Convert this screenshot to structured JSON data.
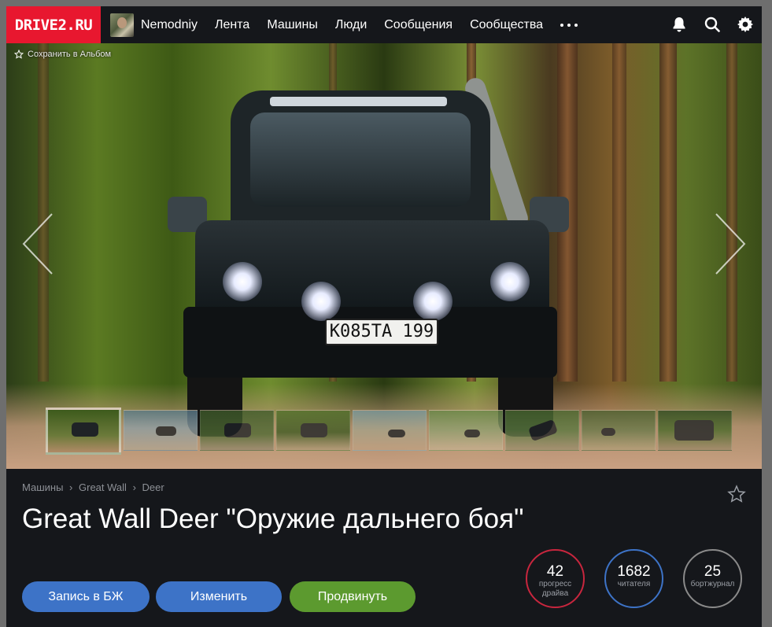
{
  "site": {
    "logo": "DRIVE2.RU"
  },
  "user": {
    "name": "Nemodniy"
  },
  "nav": {
    "items": [
      "Лента",
      "Машины",
      "Люди",
      "Сообщения",
      "Сообщества"
    ]
  },
  "hero": {
    "save_album": "Сохранить в Альбом",
    "plate": "К085ТА 199",
    "thumbnail_count": 9
  },
  "breadcrumb": {
    "items": [
      "Машины",
      "Great Wall",
      "Deer"
    ],
    "separator": "›"
  },
  "car": {
    "title": "Great Wall Deer \"Оружие дальнего боя\""
  },
  "buttons": {
    "journal": "Запись в БЖ",
    "edit": "Изменить",
    "promote": "Продвинуть"
  },
  "stats": [
    {
      "value": "42",
      "label": "прогресс драйва",
      "color": "#c8263e"
    },
    {
      "value": "1682",
      "label": "читателя",
      "color": "#3d73c7"
    },
    {
      "value": "25",
      "label": "бортжурнал",
      "color": "#8a8a8a"
    }
  ],
  "colors": {
    "brand": "#e8172f",
    "primary": "#3d73c7",
    "success": "#5c9a2f",
    "background": "#15171b"
  }
}
